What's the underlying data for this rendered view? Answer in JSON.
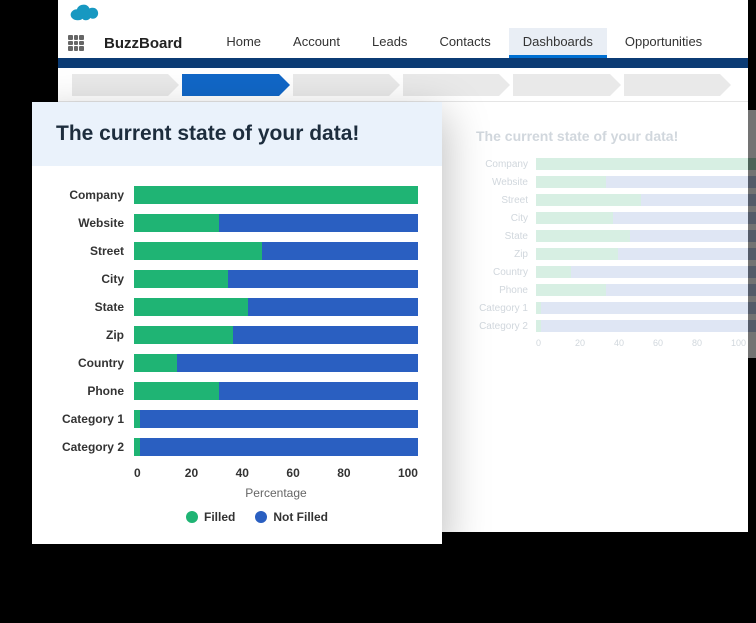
{
  "brand": "BuzzBoard",
  "nav": {
    "items": [
      {
        "label": "Home"
      },
      {
        "label": "Account"
      },
      {
        "label": "Leads"
      },
      {
        "label": "Contacts"
      },
      {
        "label": "Dashboards",
        "active": true
      },
      {
        "label": "Opportunities"
      }
    ]
  },
  "wizard": {
    "active_index": 1,
    "count": 6
  },
  "card": {
    "title": "The current state of your data!",
    "xlabel": "Percentage",
    "xticks": [
      "0",
      "20",
      "40",
      "60",
      "80",
      "100"
    ],
    "legend": {
      "filled": "Filled",
      "notfilled": "Not Filled"
    }
  },
  "chart_data": {
    "type": "bar",
    "orientation": "horizontal",
    "stacked": true,
    "title": "The current state of your data!",
    "xlabel": "Percentage",
    "ylabel": "",
    "xlim": [
      0,
      100
    ],
    "categories": [
      "Company",
      "Website",
      "Street",
      "City",
      "State",
      "Zip",
      "Country",
      "Phone",
      "Category 1",
      "Category 2"
    ],
    "series": [
      {
        "name": "Filled",
        "color": "#1fb474",
        "values": [
          100,
          30,
          45,
          33,
          40,
          35,
          15,
          30,
          2,
          2
        ]
      },
      {
        "name": "Not Filled",
        "color": "#2a5fc1",
        "values": [
          0,
          70,
          55,
          67,
          60,
          65,
          85,
          70,
          98,
          98
        ]
      }
    ],
    "legend_position": "bottom"
  },
  "faded_chart": {
    "title": "The current state of your data!",
    "xticks": [
      "0",
      "20",
      "40",
      "60",
      "80",
      "100"
    ],
    "categories": [
      "Company",
      "Website",
      "Street",
      "City",
      "State",
      "Zip",
      "Country",
      "Phone",
      "Category 1",
      "Category 2"
    ],
    "filled": [
      100,
      30,
      45,
      33,
      40,
      35,
      15,
      30,
      2,
      2
    ]
  }
}
